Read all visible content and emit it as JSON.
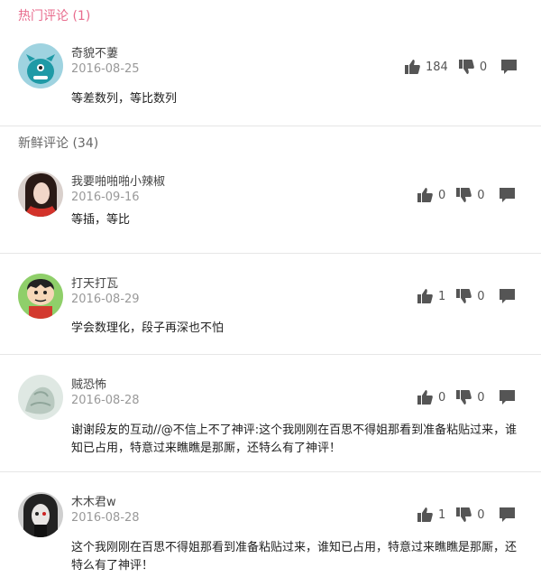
{
  "hot": {
    "title": "热门评论 (1)",
    "comments": [
      {
        "user": "奇貌不萋",
        "date": "2016-08-25",
        "text": "等差数列，等比数列",
        "likes": "184",
        "dislikes": "0"
      }
    ]
  },
  "fresh": {
    "title": "新鲜评论 (34)",
    "comments": [
      {
        "user": "我要啪啪啪小辣椒",
        "date": "2016-09-16",
        "text": "等插，等比",
        "likes": "0",
        "dislikes": "0"
      },
      {
        "user": "打天打瓦",
        "date": "2016-08-29",
        "text": "学会数理化，段子再深也不怕",
        "likes": "1",
        "dislikes": "0"
      },
      {
        "user": "贼恐怖",
        "date": "2016-08-28",
        "text": "谢谢段友的互动//@不信上不了神评:这个我刚刚在百思不得姐那看到准备粘贴过来，谁知已占用，特意过来瞧瞧是那厮，还特么有了神评！",
        "likes": "0",
        "dislikes": "0"
      },
      {
        "user": "木木君w",
        "date": "2016-08-28",
        "text": "这个我刚刚在百思不得姐那看到准备粘贴过来，谁知已占用，特意过来瞧瞧是那厮，还特么有了神评！",
        "likes": "1",
        "dislikes": "0"
      }
    ]
  },
  "icons": {
    "like": "thumbs-up-icon",
    "dislike": "thumbs-down-icon",
    "reply": "comment-icon"
  },
  "colors": {
    "accent": "#e86b8d",
    "icon": "#555555"
  }
}
